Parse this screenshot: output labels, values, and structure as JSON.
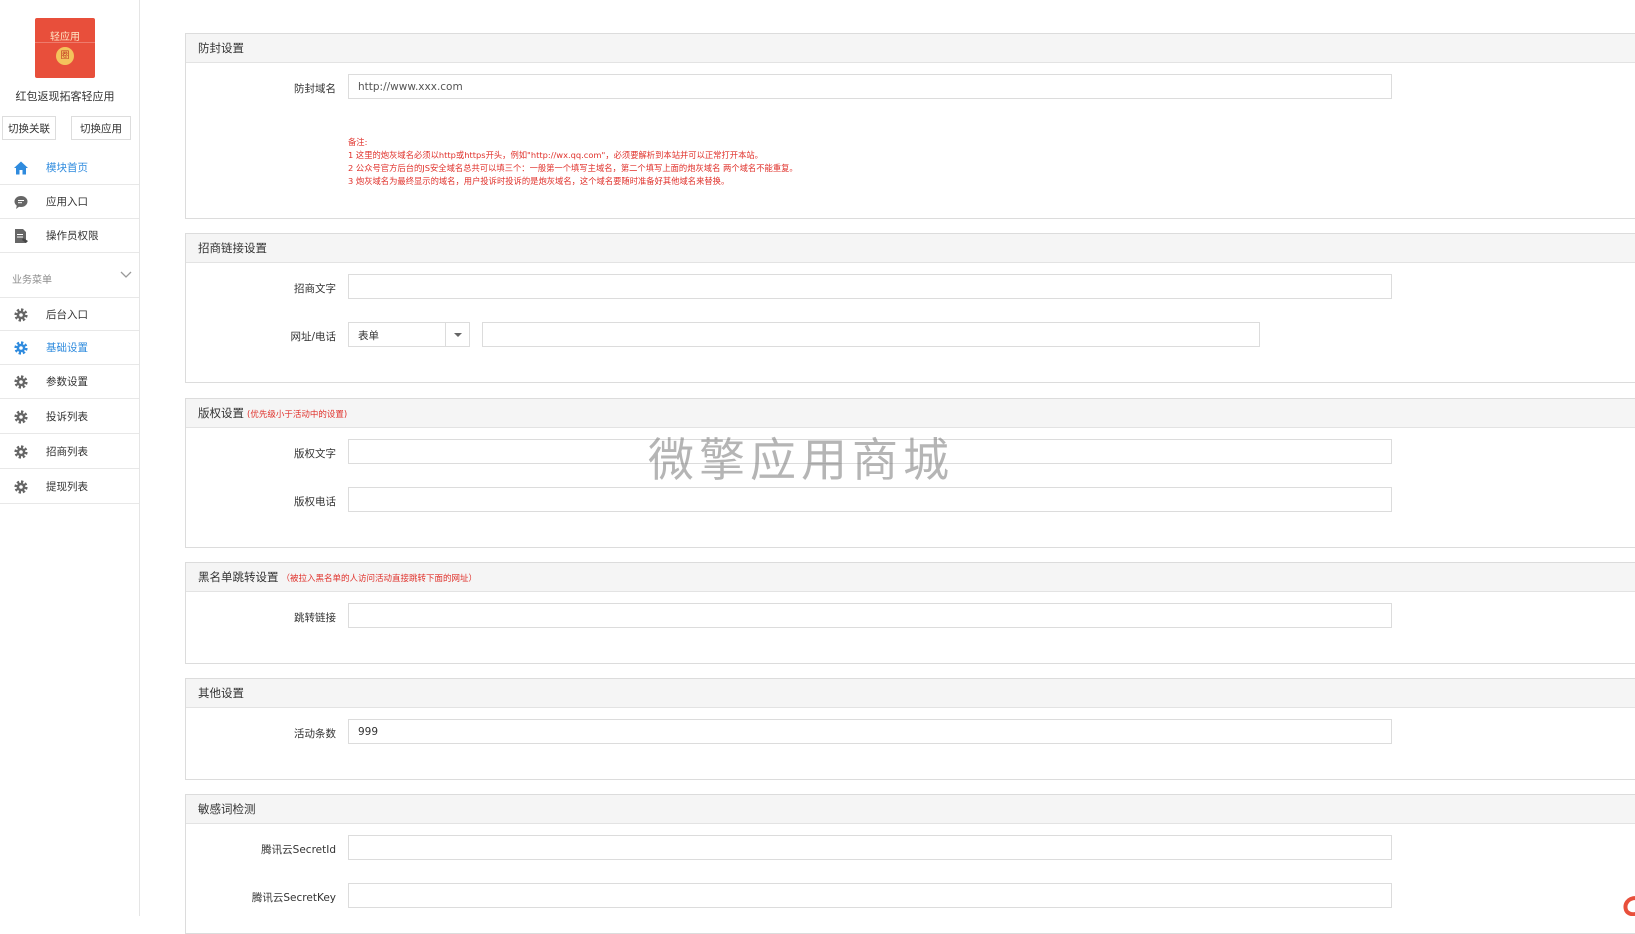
{
  "sidebar": {
    "logo_text": "轻应用",
    "logo_badge": "圈",
    "app_name": "红包返现拓客轻应用",
    "switch_relation": "切换关联",
    "switch_app": "切换应用",
    "nav_items": [
      {
        "label": "模块首页",
        "icon": "home-icon",
        "active": true
      },
      {
        "label": "应用入口",
        "icon": "chat-icon",
        "active": false
      },
      {
        "label": "操作员权限",
        "icon": "document-icon",
        "active": false
      }
    ],
    "section_title": "业务菜单",
    "business_items": [
      {
        "label": "后台入口",
        "icon": "gear-icon",
        "active": false
      },
      {
        "label": "基础设置",
        "icon": "gear-icon",
        "active": true
      },
      {
        "label": "参数设置",
        "icon": "gear-icon",
        "active": false
      },
      {
        "label": "投诉列表",
        "icon": "gear-icon",
        "active": false
      },
      {
        "label": "招商列表",
        "icon": "gear-icon",
        "active": false
      },
      {
        "label": "提现列表",
        "icon": "gear-icon",
        "active": false
      }
    ],
    "active_color": "#2f8bde"
  },
  "anti_block": {
    "title": "防封设置",
    "domain_label": "防封域名",
    "domain_placeholder": "http://www.xxx.com",
    "notes": [
      "备注:",
      "1 这里的炮灰域名必须以http或https开头，例如\"http://wx.qq.com\"，必须要解析到本站并可以正常打开本站。",
      "2 公众号官方后台的JS安全域名总共可以填三个：一般第一个填写主域名，第二个填写上面的炮灰域名 两个域名不能重复。",
      "3 炮灰域名为最终显示的域名，用户投诉时投诉的是炮灰域名，这个域名要随时准备好其他域名来替换。"
    ]
  },
  "invite": {
    "title": "招商链接设置",
    "text_label": "招商文字",
    "text_value": "",
    "url_label": "网址/电话",
    "select_value": "表单",
    "url_value": ""
  },
  "copyright": {
    "title": "版权设置",
    "hint": "(优先级小于活动中的设置)",
    "text_label": "版权文字",
    "text_value": "",
    "phone_label": "版权电话",
    "phone_value": ""
  },
  "blacklist": {
    "title": "黑名单跳转设置",
    "hint": "（被拉入黑名单的人访问活动直接跳转下面的网址）",
    "link_label": "跳转链接",
    "link_value": ""
  },
  "other": {
    "title": "其他设置",
    "count_label": "活动条数",
    "count_value": "999"
  },
  "sensitive": {
    "title": "敏感词检测",
    "secret_id_label": "腾讯云SecretId",
    "secret_id_value": "",
    "secret_key_label": "腾讯云SecretKey",
    "secret_key_value": ""
  },
  "watermark": "微擎应用商城"
}
